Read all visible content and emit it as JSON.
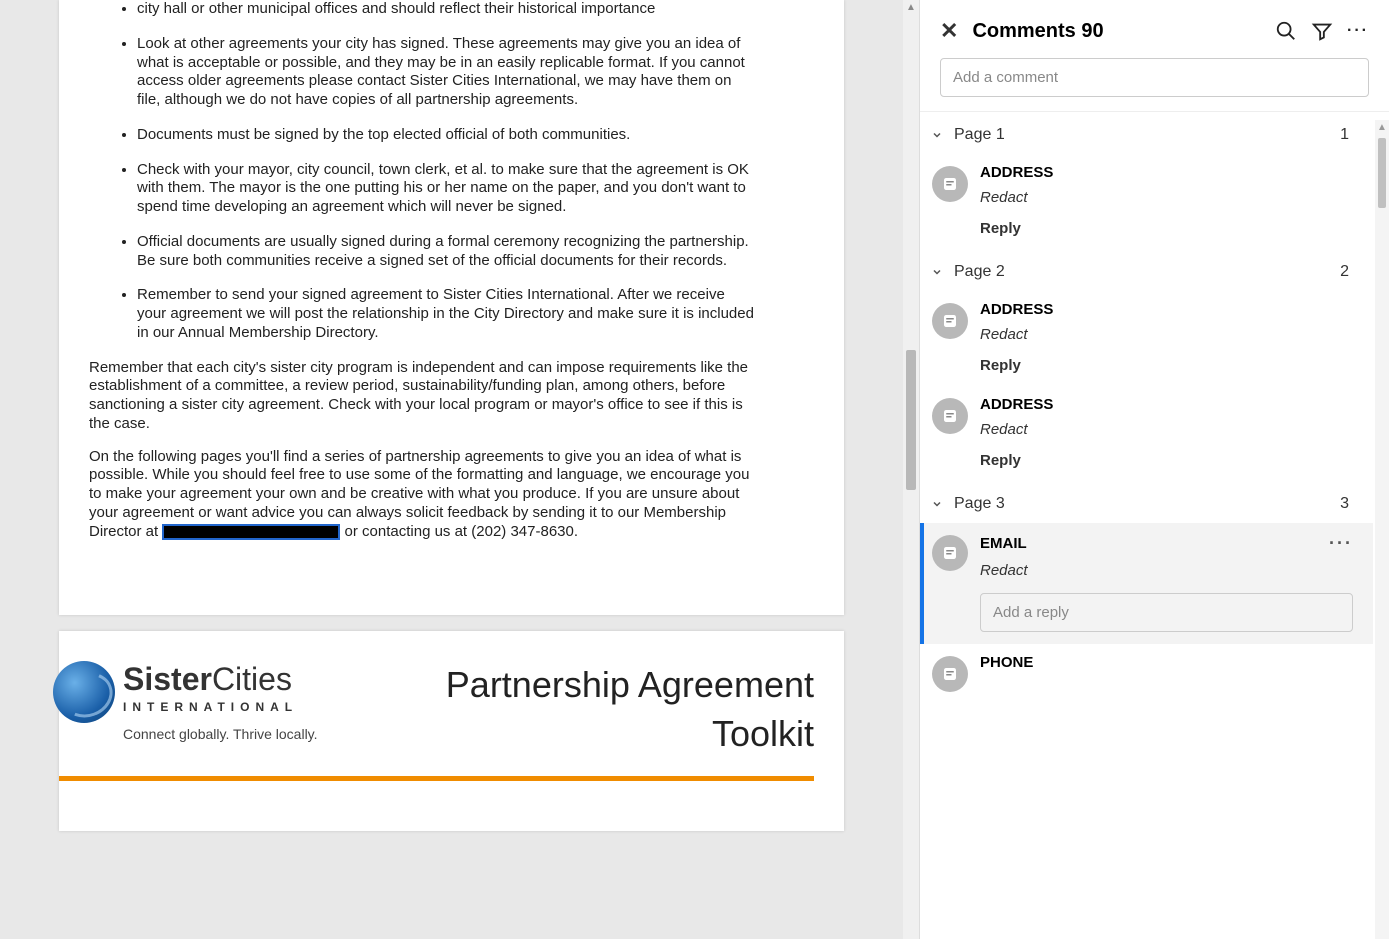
{
  "document": {
    "bullets": [
      "city hall or other municipal offices and should reflect their historical importance",
      "Look at other agreements your city has signed. These agreements may give you an idea of what is acceptable or possible, and they may be in an easily replicable format. If you cannot access older agreements please contact Sister Cities International, we may have them on file, although we do not have copies of all partnership agreements.",
      "Documents must be signed by the top elected official of both communities.",
      "Check with your mayor, city council, town clerk, et al. to make sure that the agreement is OK with them. The mayor is the one putting his or her name on the paper, and you don't want to spend time developing an agreement which will never be signed.",
      "Official documents are usually signed during a formal ceremony recognizing the partnership.  Be sure both communities receive a signed set of the official documents for their records.",
      "Remember to send your signed agreement to Sister Cities International. After we receive your agreement we will post the relationship in the City Directory and make sure it is included in our Annual Membership Directory."
    ],
    "para1": "Remember that each city's sister city program is independent and can impose requirements like the establishment of a committee, a review period, sustainability/funding plan, among others, before sanctioning a sister city agreement. Check with your local program or mayor's office to see if this is the case.",
    "para2_a": "On the following pages you'll find a series of partnership agreements to give you an idea of what is possible. While you should feel free to use some of the formatting and language, we encourage you to make your agreement your own and be creative with what you produce. If you are unsure about your agreement or want advice you can always solicit feedback by sending it to our Membership Director at ",
    "para2_b": " or contacting us at (202) 347-8630.",
    "logo_main_bold": "Sister",
    "logo_main_light": "Cities",
    "logo_sub": "INTERNATIONAL",
    "logo_tag": "Connect globally. Thrive locally.",
    "title_line1": "Partnership Agreement",
    "title_line2": "Toolkit"
  },
  "comments": {
    "title": "Comments 90",
    "add_placeholder": "Add a comment",
    "reply_placeholder": "Add a reply",
    "pages": [
      {
        "label": "Page 1",
        "count": "1",
        "items": [
          {
            "type": "ADDRESS",
            "sub": "Redact",
            "reply": "Reply",
            "selected": false
          }
        ]
      },
      {
        "label": "Page 2",
        "count": "2",
        "items": [
          {
            "type": "ADDRESS",
            "sub": "Redact",
            "reply": "Reply",
            "selected": false
          },
          {
            "type": "ADDRESS",
            "sub": "Redact",
            "reply": "Reply",
            "selected": false
          }
        ]
      },
      {
        "label": "Page 3",
        "count": "3",
        "items": [
          {
            "type": "EMAIL",
            "sub": "Redact",
            "reply": "",
            "selected": true,
            "show_reply_input": true
          },
          {
            "type": "PHONE",
            "sub": "",
            "reply": "",
            "selected": false
          }
        ]
      }
    ]
  }
}
